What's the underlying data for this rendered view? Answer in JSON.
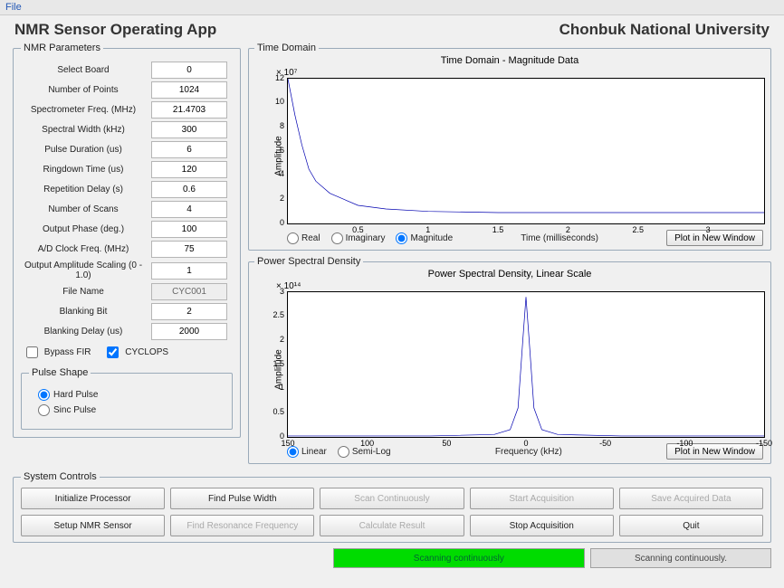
{
  "menu": {
    "file": "File"
  },
  "header": {
    "app_title": "NMR Sensor Operating App",
    "org": "Chonbuk National University"
  },
  "params": {
    "legend": "NMR Parameters",
    "rows": [
      {
        "label": "Select Board",
        "value": "0"
      },
      {
        "label": "Number of Points",
        "value": "1024"
      },
      {
        "label": "Spectrometer Freq. (MHz)",
        "value": "21.4703"
      },
      {
        "label": "Spectral Width (kHz)",
        "value": "300"
      },
      {
        "label": "Pulse Duration (us)",
        "value": "6"
      },
      {
        "label": "Ringdown Time (us)",
        "value": "120"
      },
      {
        "label": "Repetition Delay (s)",
        "value": "0.6"
      },
      {
        "label": "Number of Scans",
        "value": "4"
      },
      {
        "label": "Output Phase (deg.)",
        "value": "100"
      },
      {
        "label": "A/D Clock Freq. (MHz)",
        "value": "75"
      },
      {
        "label": "Output Amplitude Scaling (0 - 1.0)",
        "value": "1"
      },
      {
        "label": "File Name",
        "value": "CYC001",
        "readonly": true
      },
      {
        "label": "Blanking Bit",
        "value": "2"
      },
      {
        "label": "Blanking Delay (us)",
        "value": "2000"
      }
    ],
    "bypass_fir": "Bypass FIR",
    "cyclops": "CYCLOPS",
    "pulse_shape": {
      "legend": "Pulse Shape",
      "hard": "Hard Pulse",
      "sinc": "Sinc Pulse"
    }
  },
  "chart1": {
    "legend": "Time Domain",
    "title": "Time Domain - Magnitude Data",
    "exponent": "× 10⁷",
    "ylabel": "Amplitude",
    "xlabel": "Time (milliseconds)",
    "radios": {
      "real": "Real",
      "imag": "Imaginary",
      "mag": "Magnitude"
    },
    "plot_btn": "Plot in New Window"
  },
  "chart2": {
    "legend": "Power Spectral Density",
    "title": "Power Spectral Density, Linear Scale",
    "exponent": "× 10¹⁴",
    "ylabel": "Amplitude",
    "xlabel": "Frequency (kHz)",
    "radios": {
      "linear": "Linear",
      "semilog": "Semi-Log"
    },
    "plot_btn": "Plot in New Window"
  },
  "chart_data": [
    {
      "type": "line",
      "title": "Time Domain - Magnitude Data",
      "xlabel": "Time (milliseconds)",
      "ylabel": "Amplitude",
      "y_scale_exponent": 7,
      "xlim": [
        0,
        3.4
      ],
      "ylim": [
        0,
        12
      ],
      "xticks": [
        0.5,
        1,
        1.5,
        2,
        2.5,
        3
      ],
      "yticks": [
        0,
        2,
        4,
        6,
        8,
        10,
        12
      ],
      "x": [
        0,
        0.05,
        0.1,
        0.15,
        0.2,
        0.3,
        0.4,
        0.5,
        0.7,
        1.0,
        1.5,
        2.0,
        2.5,
        3.0,
        3.4
      ],
      "y": [
        12,
        9,
        6.5,
        4.5,
        3.5,
        2.5,
        2.0,
        1.5,
        1.2,
        1.0,
        0.9,
        0.9,
        0.9,
        0.9,
        0.9
      ]
    },
    {
      "type": "line",
      "title": "Power Spectral Density, Linear Scale",
      "xlabel": "Frequency (kHz)",
      "ylabel": "Amplitude",
      "y_scale_exponent": 14,
      "xlim": [
        150,
        -150
      ],
      "ylim": [
        0,
        3
      ],
      "xticks": [
        150,
        100,
        50,
        0,
        -50,
        -100,
        -150
      ],
      "yticks": [
        0,
        0.5,
        1,
        1.5,
        2,
        2.5,
        3
      ],
      "x": [
        150,
        60,
        20,
        10,
        5,
        2,
        0,
        -2,
        -5,
        -10,
        -20,
        -60,
        -150
      ],
      "y": [
        0.02,
        0.02,
        0.05,
        0.15,
        0.6,
        2.0,
        2.9,
        2.0,
        0.6,
        0.15,
        0.05,
        0.02,
        0.02
      ]
    }
  ],
  "controls": {
    "legend": "System Controls",
    "init": "Initialize Processor",
    "findpw": "Find Pulse Width",
    "scancont": "Scan Continuously",
    "startacq": "Start Acquisition",
    "savedata": "Save Acquired Data",
    "setup": "Setup NMR Sensor",
    "findres": "Find Resonance Frequency",
    "calc": "Calculate Result",
    "stopacq": "Stop Acquisition",
    "quit": "Quit"
  },
  "status": {
    "scanning1": "Scanning continuously",
    "scanning2": "Scanning continuously."
  }
}
